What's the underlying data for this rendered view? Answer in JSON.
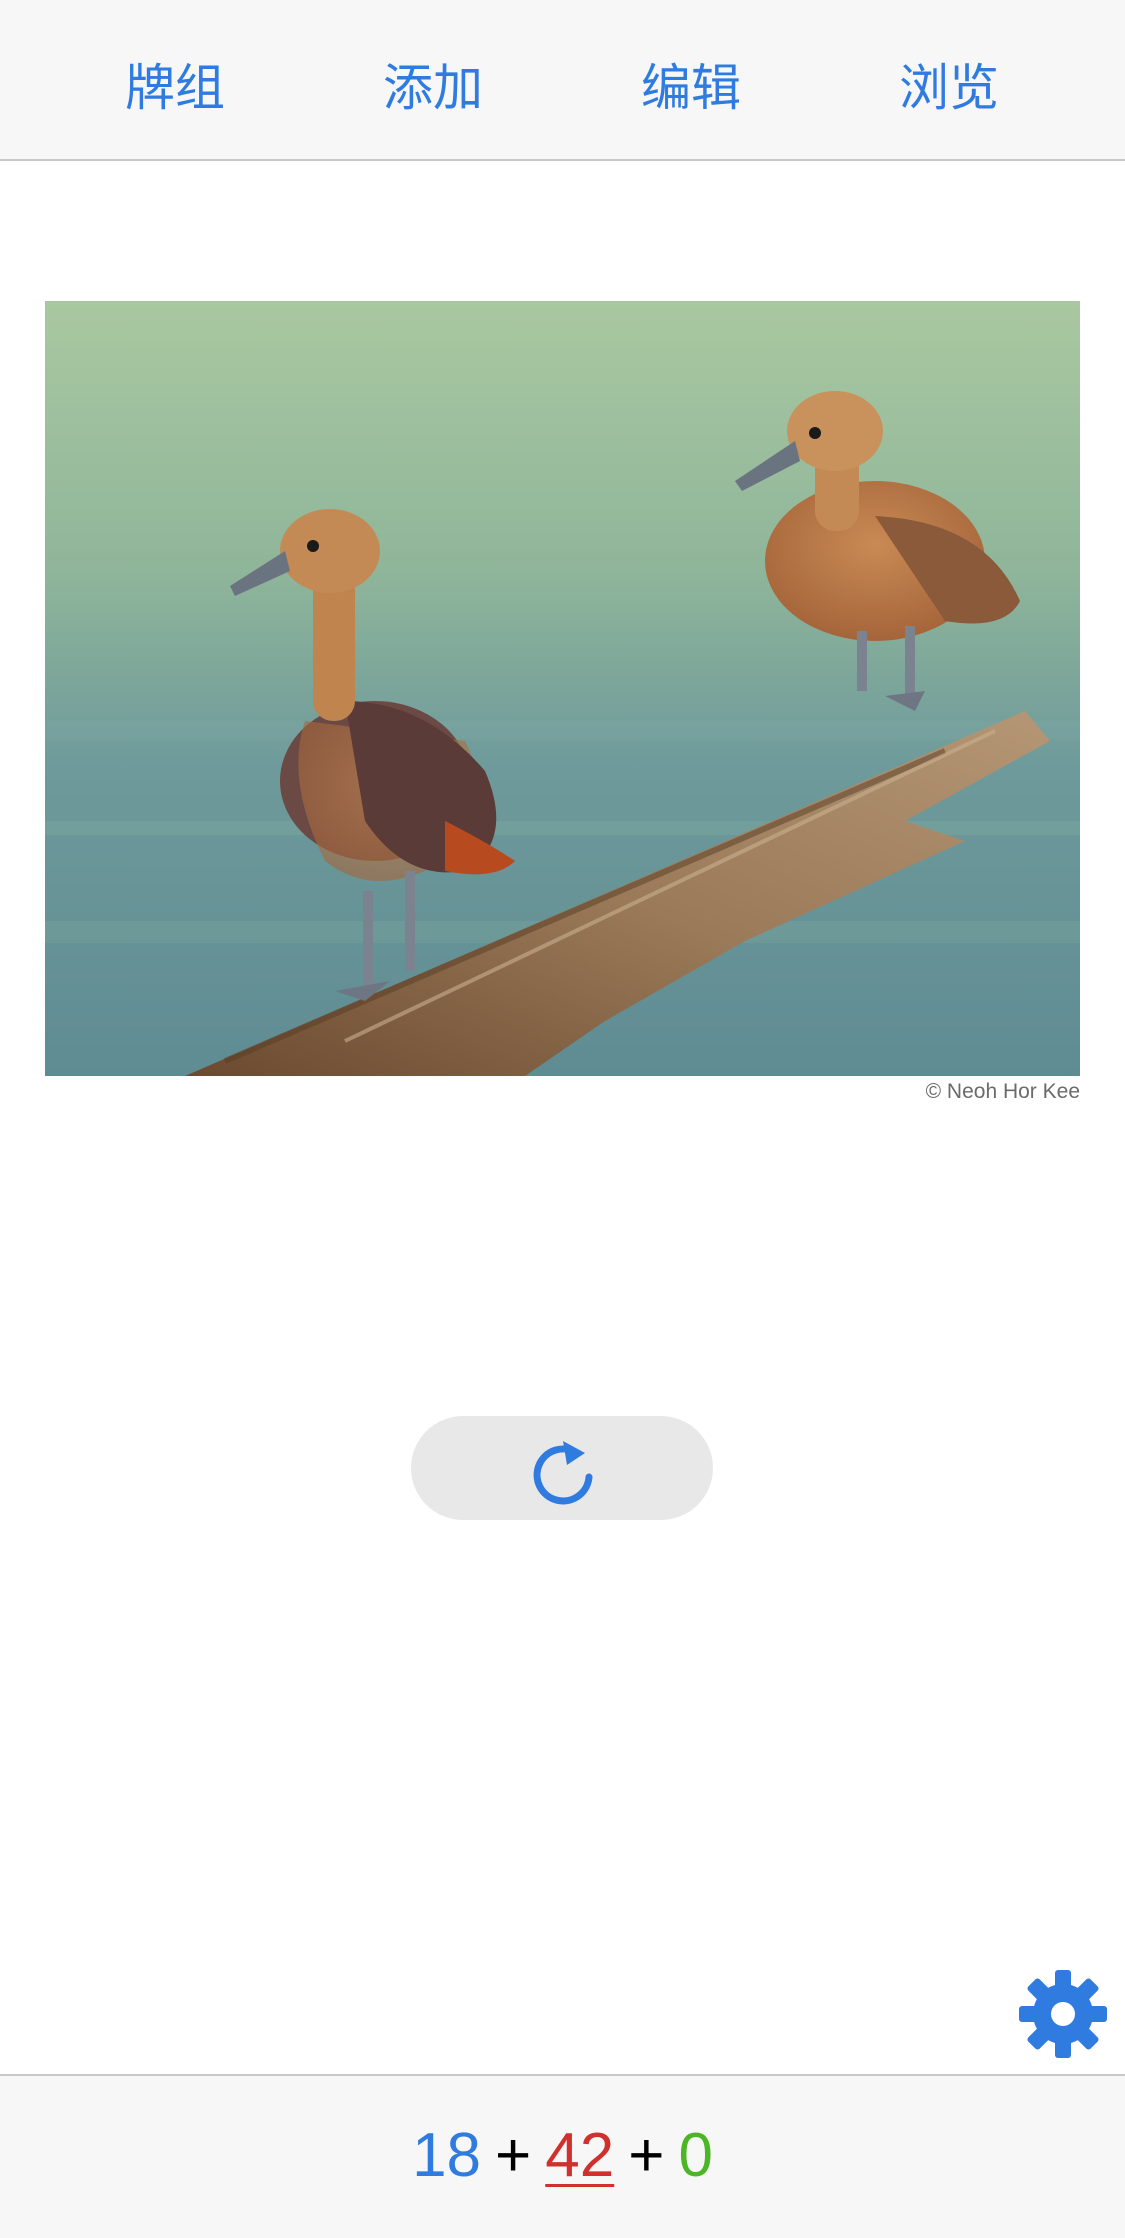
{
  "nav": {
    "decks": "牌组",
    "add": "添加",
    "edit": "编辑",
    "browse": "浏览"
  },
  "card": {
    "image_alt": "two whistling ducks on a log",
    "credit": "© Neoh Hor Kee"
  },
  "replay": {
    "icon": "replay-icon"
  },
  "settings": {
    "icon": "gear-icon"
  },
  "counts": {
    "new": "18",
    "learning": "42",
    "review": "0",
    "separator": "+"
  },
  "colors": {
    "accent": "#2f7be0",
    "new": "#2f7be0",
    "learning": "#d0312d",
    "review": "#4cb627",
    "bar_bg": "#f7f7f7"
  }
}
